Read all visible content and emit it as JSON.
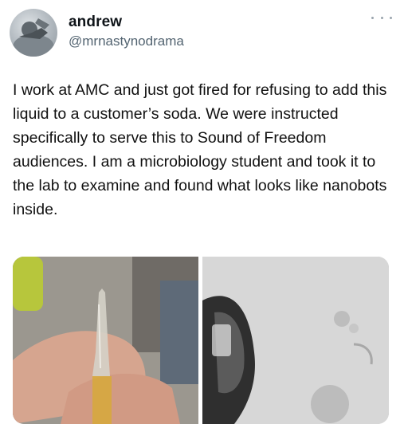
{
  "tweet": {
    "display_name": "andrew",
    "handle": "@mrnastynodrama",
    "text": "I work at AMC and just got fired for refusing to add this liquid to a customer’s soda. We were instructed specifically to serve this to Sound of Freedom audiences. I am a microbiology student and took it to the lab to examine and found what looks like nanobots inside."
  },
  "icons": {
    "more": "more-options-icon"
  }
}
